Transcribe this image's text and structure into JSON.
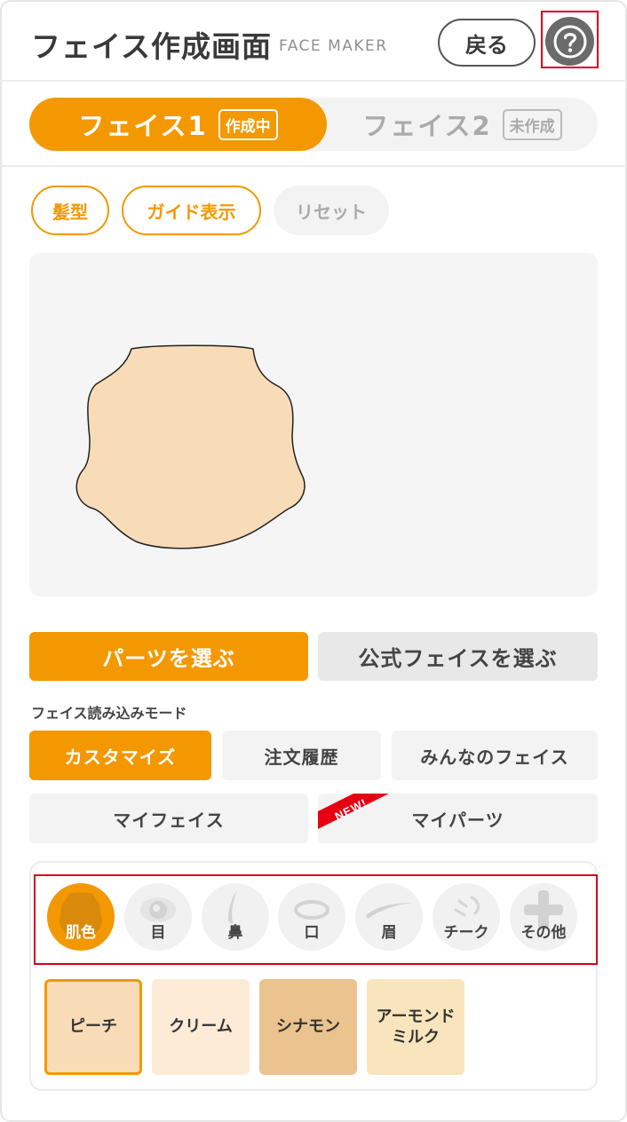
{
  "header": {
    "title": "フェイス作成画面",
    "subtitle": "FACE MAKER",
    "back_label": "戻る",
    "help_icon": "question-icon"
  },
  "face_tabs": [
    {
      "label": "フェイス1",
      "badge": "作成中",
      "active": true
    },
    {
      "label": "フェイス2",
      "badge": "未作成",
      "active": false
    }
  ],
  "toolbar": {
    "hair_label": "髪型",
    "guide_label": "ガイド表示",
    "reset_label": "リセット"
  },
  "colors": {
    "accent": "#f39800",
    "skin_peach": "#f8dcb8",
    "highlight_red": "#d9001b"
  },
  "select": {
    "parts_label": "パーツを選ぶ",
    "official_label": "公式フェイスを選ぶ"
  },
  "mode": {
    "label": "フェイス読み込みモード",
    "customize": "カスタマイズ",
    "order_history": "注文履歴",
    "everyone_faces": "みんなのフェイス",
    "my_face": "マイフェイス",
    "my_parts": "マイパーツ",
    "new_badge": "NEW!"
  },
  "categories": [
    {
      "label": "肌色",
      "icon": "skin-icon",
      "active": true
    },
    {
      "label": "目",
      "icon": "eye-icon",
      "active": false
    },
    {
      "label": "鼻",
      "icon": "nose-icon",
      "active": false
    },
    {
      "label": "口",
      "icon": "mouth-icon",
      "active": false
    },
    {
      "label": "眉",
      "icon": "eyebrow-icon",
      "active": false
    },
    {
      "label": "チーク",
      "icon": "cheek-icon",
      "active": false
    },
    {
      "label": "その他",
      "icon": "plus-icon",
      "active": false
    }
  ],
  "swatches": [
    {
      "label": "ピーチ",
      "color": "#f8dcb8",
      "selected": true
    },
    {
      "label": "クリーム",
      "color": "#fdebd8",
      "selected": false
    },
    {
      "label": "シナモン",
      "color": "#eac38e",
      "selected": false
    },
    {
      "label": "アーモンドミルク",
      "color": "#f9e5bd",
      "selected": false
    }
  ]
}
